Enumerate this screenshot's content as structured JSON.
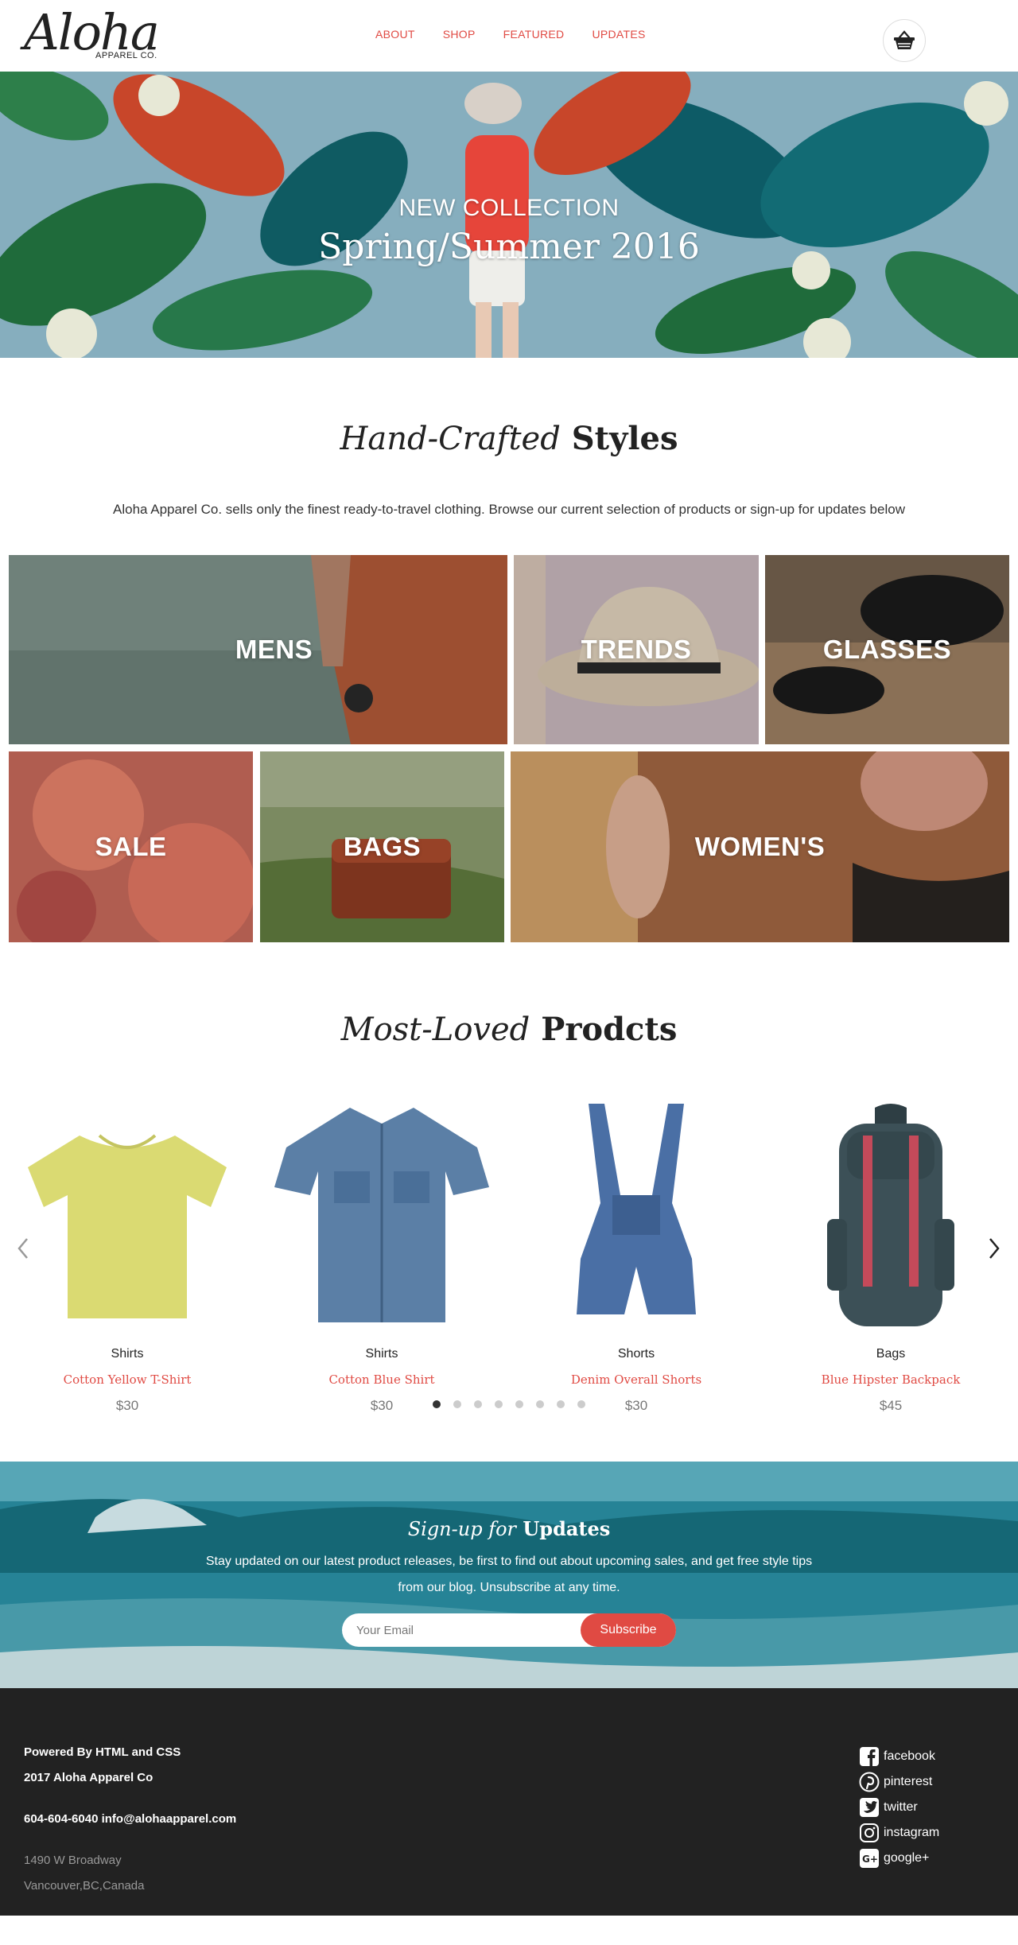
{
  "header": {
    "logo_main": "Aloha",
    "logo_sub": "APPAREL CO.",
    "nav": [
      "ABOUT",
      "SHOP",
      "FEATURED",
      "UPDATES"
    ],
    "cart_icon": "basket-icon"
  },
  "hero": {
    "kicker": "NEW COLLECTION",
    "title": "Spring/Summer 2016"
  },
  "intro": {
    "title_em": "Hand-Crafted",
    "title_strong": "Styles",
    "text": "Aloha Apparel Co. sells only the finest ready-to-travel clothing. Browse our current selection of products or sign-up for updates below"
  },
  "categories": [
    "MENS",
    "TRENDS",
    "GLASSES",
    "SALE",
    "BAGS",
    "WOMEN'S"
  ],
  "products_section": {
    "title_em": "Most-Loved",
    "title_strong": "Prodcts",
    "items": [
      {
        "category": "Shirts",
        "name": "Cotton Yellow T-Shirt",
        "price": "$30"
      },
      {
        "category": "Shirts",
        "name": "Cotton Blue Shirt",
        "price": "$30"
      },
      {
        "category": "Shorts",
        "name": "Denim Overall Shorts",
        "price": "$30"
      },
      {
        "category": "Bags",
        "name": "Blue Hipster Backpack",
        "price": "$45"
      }
    ],
    "dots_count": 8,
    "active_dot": 1
  },
  "signup": {
    "title_em": "Sign-up for",
    "title_strong": "Updates",
    "text": "Stay updated on our latest product releases, be first to find out about upcoming sales, and get free style tips from our blog. Unsubscribe at any time.",
    "placeholder": "Your Email",
    "button": "Subscribe"
  },
  "footer": {
    "powered": "Powered By HTML and CSS",
    "copyright": "2017 Aloha Apparel Co",
    "contact": "604-604-6040 info@alohaapparel.com",
    "address1": "1490 W Broadway",
    "address2": "Vancouver,BC,Canada",
    "social": [
      "facebook",
      "pinterest",
      "twitter",
      "instagram",
      "google+"
    ]
  },
  "colors": {
    "accent": "#e04a43",
    "footer_bg": "#222222"
  }
}
